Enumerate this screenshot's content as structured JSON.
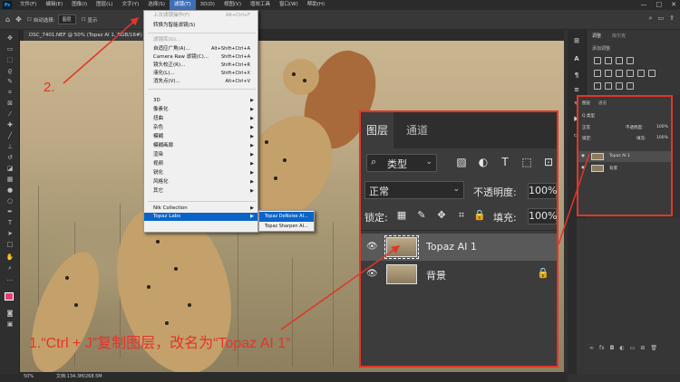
{
  "app": {
    "logo": "Ps"
  },
  "menubar": {
    "items": [
      "文件(F)",
      "编辑(E)",
      "图像(I)",
      "图层(L)",
      "文字(Y)",
      "选择(S)",
      "滤镜(T)",
      "3D(D)",
      "视图(V)",
      "增效工具",
      "窗口(W)",
      "帮助(H)"
    ],
    "active_index": 6,
    "window_controls": [
      "—",
      "□",
      "✕"
    ]
  },
  "options_bar": {
    "auto_select_label": "自动选择:",
    "auto_select_value": "图层",
    "show_label": "显示"
  },
  "document": {
    "tab_title": "DSC_7401.NEF @ 50% (Topaz AI 1, RGB/16#) *"
  },
  "filter_menu": {
    "items": [
      {
        "label": "上次滤镜操作(F)",
        "shortcut": "Alt+Ctrl+F",
        "disabled": true
      },
      {
        "label": "转换为智能滤镜(S)",
        "shortcut": ""
      },
      {
        "sep": true
      },
      {
        "label": "滤镜库(G)...",
        "shortcut": ""
      },
      {
        "label": "自适应广角(A)...",
        "shortcut": "Alt+Shift+Ctrl+A"
      },
      {
        "label": "Camera Raw 滤镜(C)...",
        "shortcut": "Shift+Ctrl+A"
      },
      {
        "label": "镜头校正(R)...",
        "shortcut": "Shift+Ctrl+R"
      },
      {
        "label": "液化(L)...",
        "shortcut": "Shift+Ctrl+X"
      },
      {
        "label": "消失点(V)...",
        "shortcut": "Alt+Ctrl+V"
      },
      {
        "sep": true
      },
      {
        "label": "3D",
        "submenu": true
      },
      {
        "label": "像素化",
        "submenu": true
      },
      {
        "label": "扭曲",
        "submenu": true
      },
      {
        "label": "杂色",
        "submenu": true
      },
      {
        "label": "模糊",
        "submenu": true
      },
      {
        "label": "模糊画廊",
        "submenu": true
      },
      {
        "label": "渲染",
        "submenu": true
      },
      {
        "label": "视频",
        "submenu": true
      },
      {
        "label": "锐化",
        "submenu": true
      },
      {
        "label": "风格化",
        "submenu": true
      },
      {
        "label": "其它",
        "submenu": true
      },
      {
        "sep": true
      },
      {
        "label": "Nik Collection",
        "submenu": true
      },
      {
        "label": "Topaz Labs",
        "submenu": true,
        "highlight": true
      }
    ]
  },
  "submenu": {
    "items": [
      {
        "label": "Topaz DeNoise AI...",
        "highlight": true
      },
      {
        "label": "Topaz Sharpen AI..."
      }
    ]
  },
  "adjust_panel": {
    "tabs": [
      "调整",
      "库尔克"
    ],
    "add_label": "添加调整"
  },
  "layers_small": {
    "tabs": [
      "图层",
      "通道"
    ],
    "filter_label": "Q 类型",
    "mode": "正常",
    "opacity_label": "不透明度:",
    "opacity_value": "100%",
    "lock_label": "锁定:",
    "fill_label": "填充:",
    "fill_value": "100%",
    "layers": [
      "Topaz AI 1",
      "背景"
    ]
  },
  "layers_zoom": {
    "tabs": [
      "图层",
      "通道"
    ],
    "filter_label": "类型",
    "mode": "正常",
    "opacity_label": "不透明度:",
    "opacity_value": "100%",
    "lock_label": "锁定:",
    "fill_label": "填充:",
    "fill_value": "100%",
    "layers": [
      {
        "name": "Topaz AI 1",
        "selected": true,
        "locked": false
      },
      {
        "name": "背景",
        "selected": false,
        "locked": true
      }
    ]
  },
  "annotations": {
    "step2": "2.",
    "step1": "1.“Ctrl + J”复制图层，改名为“Topaz AI 1”",
    "color": "#e0362a"
  },
  "status": {
    "zoom": "50%",
    "doc": "文档:134.3M/268.5M"
  },
  "colors": {
    "accent_red": "#e0362a",
    "menu_highlight": "#0a64c8",
    "panel_bg": "#3c3c3c"
  }
}
